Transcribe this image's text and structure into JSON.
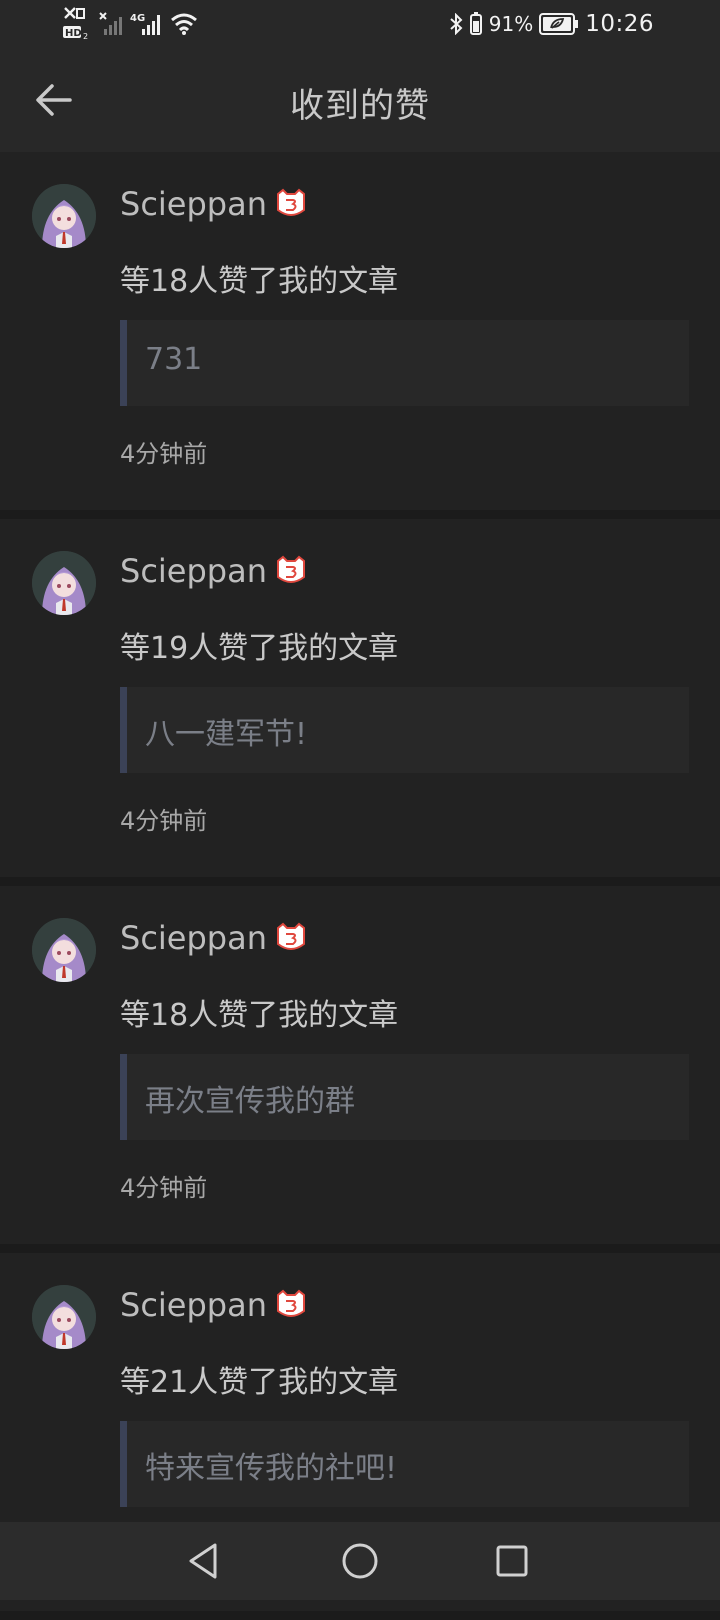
{
  "status_bar": {
    "time": "10:26",
    "battery_percent": "91%",
    "network_label": "4G",
    "hd_label": "HD",
    "icons": [
      "signal-icon",
      "wifi-icon",
      "bluetooth-icon",
      "battery-icon"
    ]
  },
  "header": {
    "title": "收到的赞",
    "back_icon": "arrow-left-icon"
  },
  "notifications": [
    {
      "username": "Scieppan",
      "like_text": "等18人赞了我的文章",
      "article_title": "731",
      "time": "4分钟前"
    },
    {
      "username": "Scieppan",
      "like_text": "等19人赞了我的文章",
      "article_title": "八一建军节!",
      "time": "4分钟前"
    },
    {
      "username": "Scieppan",
      "like_text": "等18人赞了我的文章",
      "article_title": "再次宣传我的群",
      "time": "4分钟前"
    },
    {
      "username": "Scieppan",
      "like_text": "等21人赞了我的文章",
      "article_title": "特来宣传我的社吧!",
      "time": ""
    }
  ],
  "nav_bar": {
    "buttons": [
      "back-triangle-icon",
      "home-circle-icon",
      "recents-square-icon"
    ]
  },
  "colors": {
    "background": "#1b1b1b",
    "card": "#222222",
    "header": "#282828",
    "quote_bar": "#3b4257",
    "badge": "#e0483e"
  }
}
